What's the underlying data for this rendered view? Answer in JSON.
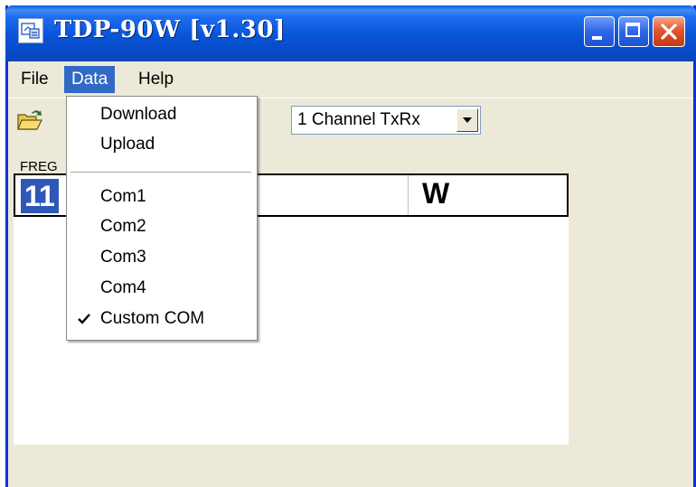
{
  "window": {
    "title": "TDP-90W [v1.30]",
    "icon": "app-icon"
  },
  "menubar": {
    "file": "File",
    "data": "Data",
    "help": "Help"
  },
  "toolbar": {
    "open_icon": "open-folder-icon",
    "channel_mode": "1 Channel TxRx"
  },
  "display": {
    "freq_label": "FREG",
    "freq_value": "11",
    "power_unit": "W"
  },
  "data_menu": {
    "items": [
      {
        "label": "Download",
        "checked": false
      },
      {
        "label": "Upload",
        "checked": false
      },
      {
        "label": "Com1",
        "checked": false
      },
      {
        "label": "Com2",
        "checked": false
      },
      {
        "label": "Com3",
        "checked": false
      },
      {
        "label": "Com4",
        "checked": false
      },
      {
        "label": "Custom COM",
        "checked": true
      }
    ]
  },
  "colors": {
    "titlebar": "#0854d7",
    "menu_highlight": "#316ac5",
    "freq_highlight": "#2e58b8",
    "window_bg": "#ece9d8"
  }
}
